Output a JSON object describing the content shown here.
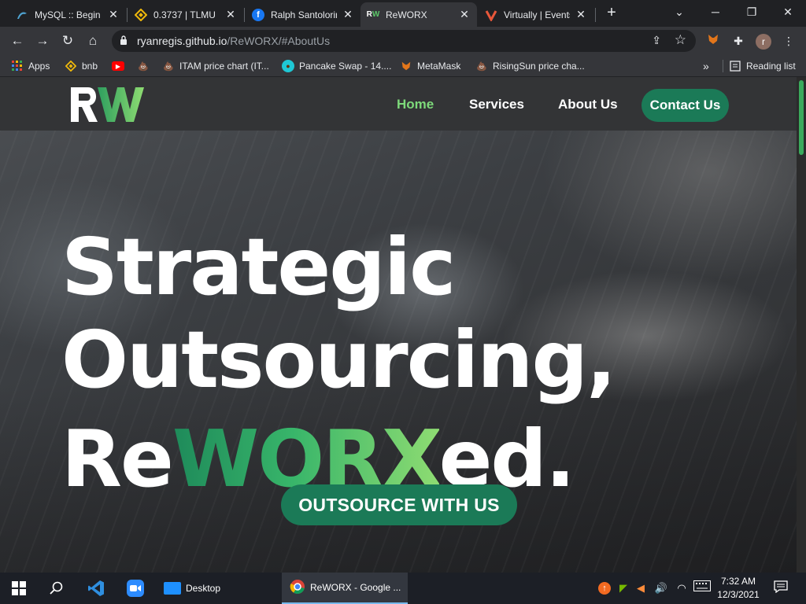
{
  "browser": {
    "tabs": [
      {
        "title": "MySQL :: Begin ’",
        "favicon": "mysql-dolphin-icon"
      },
      {
        "title": "0.3737 | TLMU",
        "favicon": "binance-icon"
      },
      {
        "title": "Ralph Santolorin",
        "favicon": "facebook-icon"
      },
      {
        "title": "ReWORX",
        "favicon": "reworx-icon"
      },
      {
        "title": "Virtually | Events",
        "favicon": "virtually-icon"
      }
    ],
    "active_tab_index": 3,
    "url_host": "ryanregis.github.io",
    "url_path": "/ReWORX/#AboutUs",
    "bookmarks": [
      {
        "label": "Apps",
        "icon": "apps-grid-icon"
      },
      {
        "label": "bnb",
        "icon": "binance-icon"
      },
      {
        "label": "",
        "icon": "youtube-icon"
      },
      {
        "label": "",
        "icon": "poop-icon"
      },
      {
        "label": "ITAM price chart (IT...",
        "icon": "poop-icon"
      },
      {
        "label": "Pancake Swap - 14....",
        "icon": "pancake-icon"
      },
      {
        "label": "MetaMask",
        "icon": "metamask-fox-icon"
      },
      {
        "label": "RisingSun price cha...",
        "icon": "poop-icon"
      }
    ],
    "reading_list_label": "Reading list",
    "profile_initial": "r"
  },
  "site": {
    "logo_text": "RW",
    "nav": [
      {
        "label": "Home",
        "active": true
      },
      {
        "label": "Services",
        "active": false
      },
      {
        "label": "About Us",
        "active": false
      }
    ],
    "contact_label": "Contact Us",
    "hero": {
      "line1": "Strategic",
      "line2": "Outsourcing,",
      "line3_prefix": "Re",
      "line3_highlight": "WORX",
      "line3_suffix": "ed."
    },
    "cta_label": "OUTSOURCE WITH US",
    "colors": {
      "accent": "#1b7a57",
      "active_link": "#7dd97a",
      "gradient_end": "#8edc72"
    }
  },
  "taskbar": {
    "desktop_label": "Desktop",
    "chrome_window_label": "ReWORX - Google ...",
    "time": "7:32 AM",
    "date": "12/3/2021"
  }
}
